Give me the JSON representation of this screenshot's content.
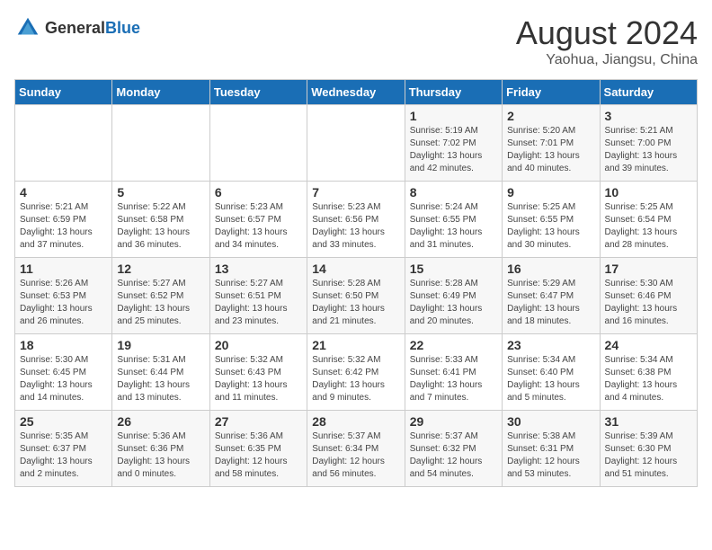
{
  "logo": {
    "general": "General",
    "blue": "Blue"
  },
  "title": "August 2024",
  "subtitle": "Yaohua, Jiangsu, China",
  "days_header": [
    "Sunday",
    "Monday",
    "Tuesday",
    "Wednesday",
    "Thursday",
    "Friday",
    "Saturday"
  ],
  "weeks": [
    [
      {
        "day": "",
        "info": ""
      },
      {
        "day": "",
        "info": ""
      },
      {
        "day": "",
        "info": ""
      },
      {
        "day": "",
        "info": ""
      },
      {
        "day": "1",
        "info": "Sunrise: 5:19 AM\nSunset: 7:02 PM\nDaylight: 13 hours\nand 42 minutes."
      },
      {
        "day": "2",
        "info": "Sunrise: 5:20 AM\nSunset: 7:01 PM\nDaylight: 13 hours\nand 40 minutes."
      },
      {
        "day": "3",
        "info": "Sunrise: 5:21 AM\nSunset: 7:00 PM\nDaylight: 13 hours\nand 39 minutes."
      }
    ],
    [
      {
        "day": "4",
        "info": "Sunrise: 5:21 AM\nSunset: 6:59 PM\nDaylight: 13 hours\nand 37 minutes."
      },
      {
        "day": "5",
        "info": "Sunrise: 5:22 AM\nSunset: 6:58 PM\nDaylight: 13 hours\nand 36 minutes."
      },
      {
        "day": "6",
        "info": "Sunrise: 5:23 AM\nSunset: 6:57 PM\nDaylight: 13 hours\nand 34 minutes."
      },
      {
        "day": "7",
        "info": "Sunrise: 5:23 AM\nSunset: 6:56 PM\nDaylight: 13 hours\nand 33 minutes."
      },
      {
        "day": "8",
        "info": "Sunrise: 5:24 AM\nSunset: 6:55 PM\nDaylight: 13 hours\nand 31 minutes."
      },
      {
        "day": "9",
        "info": "Sunrise: 5:25 AM\nSunset: 6:55 PM\nDaylight: 13 hours\nand 30 minutes."
      },
      {
        "day": "10",
        "info": "Sunrise: 5:25 AM\nSunset: 6:54 PM\nDaylight: 13 hours\nand 28 minutes."
      }
    ],
    [
      {
        "day": "11",
        "info": "Sunrise: 5:26 AM\nSunset: 6:53 PM\nDaylight: 13 hours\nand 26 minutes."
      },
      {
        "day": "12",
        "info": "Sunrise: 5:27 AM\nSunset: 6:52 PM\nDaylight: 13 hours\nand 25 minutes."
      },
      {
        "day": "13",
        "info": "Sunrise: 5:27 AM\nSunset: 6:51 PM\nDaylight: 13 hours\nand 23 minutes."
      },
      {
        "day": "14",
        "info": "Sunrise: 5:28 AM\nSunset: 6:50 PM\nDaylight: 13 hours\nand 21 minutes."
      },
      {
        "day": "15",
        "info": "Sunrise: 5:28 AM\nSunset: 6:49 PM\nDaylight: 13 hours\nand 20 minutes."
      },
      {
        "day": "16",
        "info": "Sunrise: 5:29 AM\nSunset: 6:47 PM\nDaylight: 13 hours\nand 18 minutes."
      },
      {
        "day": "17",
        "info": "Sunrise: 5:30 AM\nSunset: 6:46 PM\nDaylight: 13 hours\nand 16 minutes."
      }
    ],
    [
      {
        "day": "18",
        "info": "Sunrise: 5:30 AM\nSunset: 6:45 PM\nDaylight: 13 hours\nand 14 minutes."
      },
      {
        "day": "19",
        "info": "Sunrise: 5:31 AM\nSunset: 6:44 PM\nDaylight: 13 hours\nand 13 minutes."
      },
      {
        "day": "20",
        "info": "Sunrise: 5:32 AM\nSunset: 6:43 PM\nDaylight: 13 hours\nand 11 minutes."
      },
      {
        "day": "21",
        "info": "Sunrise: 5:32 AM\nSunset: 6:42 PM\nDaylight: 13 hours\nand 9 minutes."
      },
      {
        "day": "22",
        "info": "Sunrise: 5:33 AM\nSunset: 6:41 PM\nDaylight: 13 hours\nand 7 minutes."
      },
      {
        "day": "23",
        "info": "Sunrise: 5:34 AM\nSunset: 6:40 PM\nDaylight: 13 hours\nand 5 minutes."
      },
      {
        "day": "24",
        "info": "Sunrise: 5:34 AM\nSunset: 6:38 PM\nDaylight: 13 hours\nand 4 minutes."
      }
    ],
    [
      {
        "day": "25",
        "info": "Sunrise: 5:35 AM\nSunset: 6:37 PM\nDaylight: 13 hours\nand 2 minutes."
      },
      {
        "day": "26",
        "info": "Sunrise: 5:36 AM\nSunset: 6:36 PM\nDaylight: 13 hours\nand 0 minutes."
      },
      {
        "day": "27",
        "info": "Sunrise: 5:36 AM\nSunset: 6:35 PM\nDaylight: 12 hours\nand 58 minutes."
      },
      {
        "day": "28",
        "info": "Sunrise: 5:37 AM\nSunset: 6:34 PM\nDaylight: 12 hours\nand 56 minutes."
      },
      {
        "day": "29",
        "info": "Sunrise: 5:37 AM\nSunset: 6:32 PM\nDaylight: 12 hours\nand 54 minutes."
      },
      {
        "day": "30",
        "info": "Sunrise: 5:38 AM\nSunset: 6:31 PM\nDaylight: 12 hours\nand 53 minutes."
      },
      {
        "day": "31",
        "info": "Sunrise: 5:39 AM\nSunset: 6:30 PM\nDaylight: 12 hours\nand 51 minutes."
      }
    ]
  ]
}
